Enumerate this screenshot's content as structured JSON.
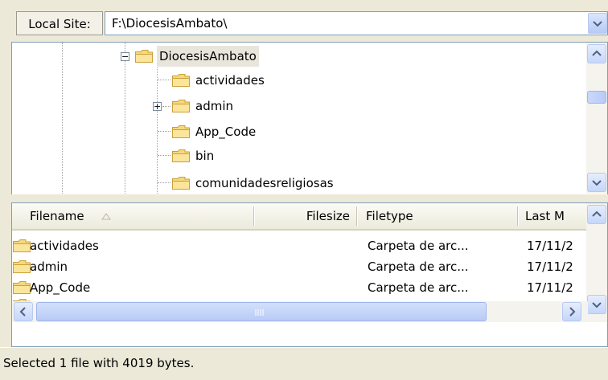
{
  "local_site": {
    "label": "Local Site:",
    "path": "F:\\DiocesisAmbato\\"
  },
  "tree": {
    "root": "DiocesisAmbato",
    "children": [
      "actividades",
      "admin",
      "App_Code",
      "bin",
      "comunidadesreligiosas"
    ]
  },
  "list": {
    "columns": [
      "Filename",
      "Filesize",
      "Filetype",
      "Last M"
    ],
    "rows": [
      {
        "name": "actividades",
        "size": "",
        "type": "Carpeta de arc...",
        "date": "17/11/2"
      },
      {
        "name": "admin",
        "size": "",
        "type": "Carpeta de arc...",
        "date": "17/11/2"
      },
      {
        "name": "App_Code",
        "size": "",
        "type": "Carpeta de arc...",
        "date": "17/11/2"
      }
    ]
  },
  "status": {
    "text": "Selected 1 file with 4019 bytes."
  },
  "colors": {
    "folder": "#f5d574",
    "accent": "#7f9db9"
  },
  "icons": [
    "folder-icon",
    "expand-icon",
    "collapse-icon",
    "dropdown-arrow-icon",
    "scroll-up-icon",
    "scroll-down-icon",
    "scroll-left-icon",
    "scroll-right-icon",
    "sort-arrow-icon"
  ]
}
